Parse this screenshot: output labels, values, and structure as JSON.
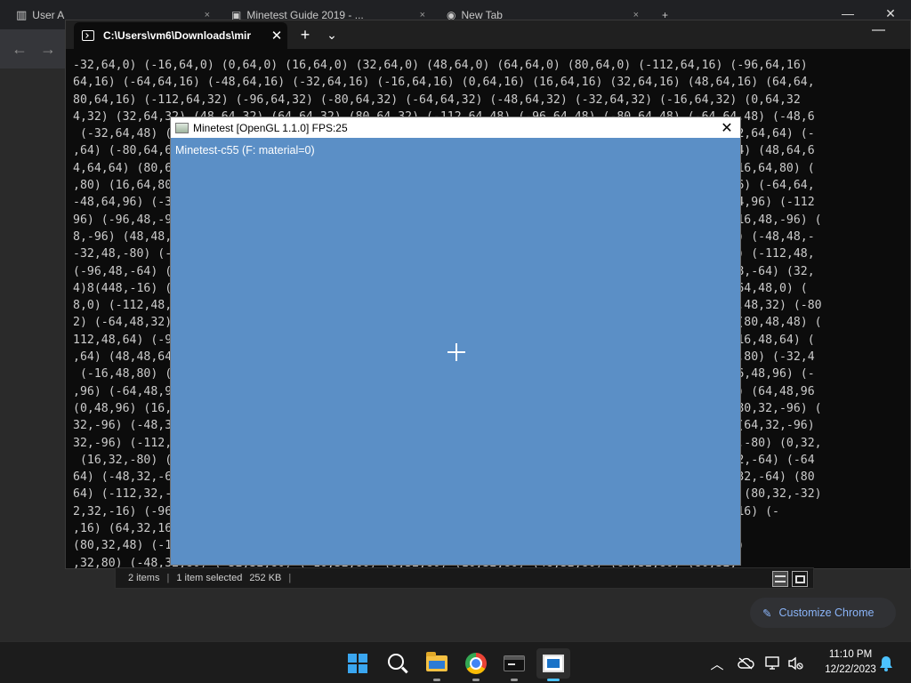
{
  "chrome": {
    "tabs": [
      {
        "label": "User A",
        "close": "×"
      },
      {
        "label": "Minetest Guide 2019 - ...",
        "close": "×"
      },
      {
        "label": "New Tab",
        "close": "×"
      }
    ],
    "new_tab": "+",
    "back": "←",
    "forward": "→",
    "customize_label": "Customize Chrome",
    "window_controls": {
      "minimize": "—",
      "maximize": "□",
      "close": "✕"
    }
  },
  "terminal": {
    "tab_title": "C:\\Users\\vm6\\Downloads\\mir",
    "tab_close": "✕",
    "new_tab": "+",
    "dropdown": "⌄",
    "minimize": "—",
    "lines": [
      "-32,64,0) (-16,64,0) (0,64,0) (16,64,0) (32,64,0) (48,64,0) (64,64,0) (80,64,0) (-112,64,16) (-96,64,16)",
      "64,16) (-64,64,16) (-48,64,16) (-32,64,16) (-16,64,16) (0,64,16) (16,64,16) (32,64,16) (48,64,16) (64,64,",
      "80,64,16) (-112,64,32) (-96,64,32) (-80,64,32) (-64,64,32) (-48,64,32) (-32,64,32) (-16,64,32) (0,64,32",
      "4,32) (32,64,32) (48,64,32) (64,64,32) (80,64,32) (-112,64,48) (-96,64,48) (-80,64,48) (-64,64,48) (-48,6",
      " (-32,64,48) (-16,64,48) (0,64,48) (16,64,48) (32,64,48) (48,64,48) (64,64,48) (80,64,48) (-112,64,64) (-",
      ",64) (-80,64,64) (-64,64,64) (-48,64,64) (-32,64,64) (-16,64,64) (0,64,64) (16,64,64) (32,64,64) (48,64,6",
      "4,64,64) (80,64,64) (-112,64,80) (-96,64,80) (-80,64,80) (-64,64,80) (-48,64,80) (32,64,80) (-16,64,80) (",
      ",80) (16,64,80) (32,64,80) (48,64,80) (64,64,80) (80,64,80) (-112,64,96) (-96,64,96) (-80,64,96) (-64,64,",
      "-48,64,96) (-32,64,96) (-16,64,96) (0,64,96) (16,64,96) (32,64,96) (48,64,96) (64,64,96) (80,64,96) (-112",
      "96) (-96,48,-96) (-80,48,-96) (-64,48,-96) (-48,48,-96) (-32,48,-96) (-16,48,-96) (0,48,-96) (16,48,-96) (",
      "8,-96) (48,48,-96) (64,48,-96) (80,48,-96) (-112,48,-80) (-96,48,-80) (-80,48,-80) (-64,48,-80) (-48,48,-",
      "-32,48,-80) (-16,48,-80) (0,48,-80) (16,48,-80) (32,48,-80) (48,48,-80) (64,48,-80) (80,48,-80) (-112,48,",
      "(-96,48,-64) (-80,48,-64) (-64,48,-64) (-48,48,-64) (-32,48,-64) (-16,48,-64) (0,48,-64) (16,48,-64) (32,",
      "4)8(448,-16) (64,48,-16) (80,48,-16) (-112,48,0) (-96,48,0) (-80,48,0) (-64,48,0) (-48,48,0) (64,48,0) (",
      "8,0) (-112,48,16) (-96,48,16) (-80,48,16) (-64,48,16) (-48,48,16) (-32,48,16) (-16,48,32) (-96,48,32) (-80",
      "2) (-64,48,32) (-48,48,32) (-32,48,32) (-16,48,32) (0,48,32) (16,48,32) (32,48,32) (64,48,48) (80,48,48) (",
      "112,48,64) (-96,48,64) (-80,48,64) (-64,48,64) (-48,48,64) (-32,48,64) (-16,48,64) (0,48,64) (16,48,64) (",
      ",64) (48,48,64) (64,48,64) (80,48,64) (-112,48,80) (-96,48,80) (-80,48,80) (-64,48,80) (-48,48,80) (-32,4",
      " (-16,48,80) (0,48,80) (16,48,80) (32,48,80) (48,48,80) (64,48,80) (80,48,80) (-112,48,96) (-96,48,96) (-",
      ",96) (-64,48,96) (-48,48,96) (-32,48,96) (-16,48,96) (0,48,96) (16,48,96) (32,48,96) (48,48,96) (64,48,96",
      "(0,48,96) (16,48,96) (32,48,96) (48,48,96) (64,48,96) (80,48,96) (-112,32,-96) (-96,32,-96) (-80,32,-96) (",
      "32,-96) (-48,32,-96) (-32,32,-96) (-16,32,-96) (0,32,-96) (16,32,-96) (32,32,-96) (48,32,-96) (64,32,-96)",
      "32,-96) (-112,32,-80) (-96,32,-80) (-80,32,-80) (-64,32,-80) (-48,32,-80) (-32,32,-80) (-16,32,-80) (0,32,",
      " (16,32,-80) (32,32,-80) (48,32,-80) (64,32,-80) (80,32,-80) (-112,32,-64) (-96,32,-64) (-80,32,-64) (-64",
      "64) (-48,32,-64) (-32,32,-64) (-16,32,-64) (0,32,-64) (16,32,-64) (32,32,-64) (48,32,-64) (64,32,-64) (80",
      "64) (-112,32,-32) (-96,32,-32) (-80,32,-32) (-64,32,-32) (-48,32,-32) (-32,32,-32) (64,32,-32) (80,32,-32)",
      "2,32,-16) (-96,32,-16) (-80,32,-16) (-64,32,-16) (-48,32,-16) (-32,32,-16) (80,32,0) (-112,32,16) (-",
      ",16) (64,32,16) (80,32,16) (-112,32,32) (-96,32,32) (-80,32,32) (80,32,48) (-96,32,48) (64,32",
      "(80,32,48) (-112,32,64) (-96,32,64) (-80,32,64) (-64,32,64) (-48,32,64) (-96,32,80) (-80,32,80)",
      ",32,80) (-48,32,80) (-32,32,80) (-16,32,80) (0,32,80) (16,32,80) (48,32,80) (64,32,80) (80,32,"
    ]
  },
  "explorer_status": {
    "items": "2 items",
    "selected": "1 item selected",
    "size": "252 KB",
    "separator": "|"
  },
  "minetest": {
    "window_title": "Minetest [OpenGL 1.1.0] FPS:25",
    "close": "✕",
    "hud_text": "Minetest-c55 (F: material=0)",
    "sky_color": "#5b8fc6"
  },
  "taskbar": {
    "apps": [
      "start-icon",
      "search-icon",
      "file-explorer-icon",
      "chrome-icon",
      "terminal-icon",
      "minetest-icon"
    ],
    "tray_chevron": "^",
    "time": "11:10 PM",
    "date": "12/22/2023"
  },
  "colors": {
    "accent": "#4cc2ff",
    "customize_text": "#8ab4f8",
    "terminal_bg": "#0c0c0c"
  }
}
